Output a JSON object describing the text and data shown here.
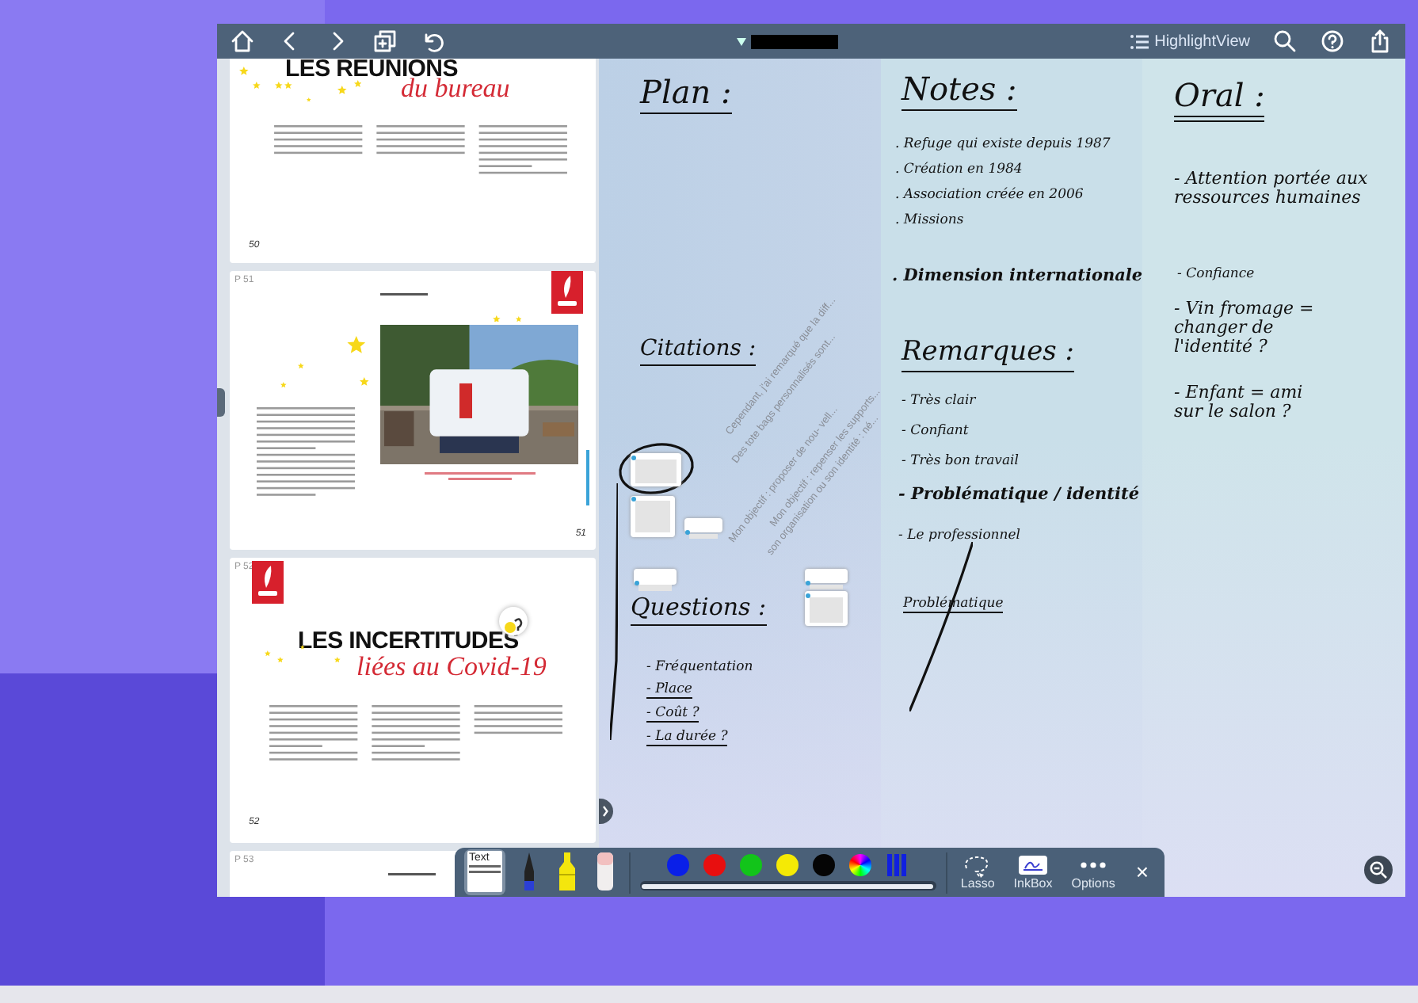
{
  "toolbar": {
    "view_label": "HighlightView"
  },
  "document": {
    "pages": [
      {
        "kind": "title",
        "title": "LES REUNIONS",
        "subtitle": "du bureau",
        "folio": "50"
      },
      {
        "label": "P 51",
        "folio": "51"
      },
      {
        "kind": "title",
        "label": "P 52",
        "title": "LES INCERTITUDES",
        "subtitle": "liées au Covid-19",
        "folio": "52"
      },
      {
        "kind": "stub",
        "label": "P 53"
      }
    ]
  },
  "workspace": {
    "notes": [
      {
        "kind": "heading",
        "text": "Plan :"
      },
      {
        "kind": "heading",
        "text": "Citations :"
      },
      {
        "kind": "heading",
        "text": "Questions :"
      },
      {
        "kind": "line",
        "text": "- Fréquentation"
      },
      {
        "kind": "line",
        "text": "- Place"
      },
      {
        "kind": "line",
        "text": "- Coût ?"
      },
      {
        "kind": "line",
        "text": "- La durée ?"
      },
      {
        "kind": "heading",
        "text": "Notes :"
      },
      {
        "kind": "line",
        "text": ". Refuge qui existe depuis 1987"
      },
      {
        "kind": "line",
        "text": ". Création en 1984"
      },
      {
        "kind": "line",
        "text": ". Association créée en 2006"
      },
      {
        "kind": "line",
        "text": ". Missions"
      },
      {
        "kind": "emphasis",
        "text": ". Dimension internationale"
      },
      {
        "kind": "heading",
        "text": "Remarques :"
      },
      {
        "kind": "line",
        "text": "- Très clair"
      },
      {
        "kind": "line",
        "text": "- Confiant"
      },
      {
        "kind": "line",
        "text": "- Très bon travail"
      },
      {
        "kind": "emphasis",
        "text": "- Problématique / identité"
      },
      {
        "kind": "line",
        "text": "- Le professionnel"
      },
      {
        "kind": "line",
        "text": "Problématique"
      },
      {
        "kind": "heading",
        "text": "Oral :"
      },
      {
        "kind": "line",
        "text": "- Attention portée aux ressources humaines"
      },
      {
        "kind": "line",
        "text": "- Confiance"
      },
      {
        "kind": "line",
        "text": "- Vin fromage = changer de l'identité ?"
      },
      {
        "kind": "line",
        "text": "- Enfant = ami sur le salon ?"
      }
    ],
    "excerpts": [
      "Cependant, j'ai remarqué que la diff...",
      "Des tote bags personnalisés sont...",
      "Mon objectif : proposer de nou- vell...",
      "Mon objectif : repenser les supports...",
      "son organisation ou son identité : né..."
    ]
  },
  "ink_toolbar": {
    "tools": [
      {
        "kind": "text",
        "label": "Text",
        "selected": true
      },
      {
        "kind": "pen",
        "selected": false
      },
      {
        "kind": "highlighter",
        "selected": false
      },
      {
        "kind": "eraser",
        "selected": false
      }
    ],
    "colors": [
      {
        "color": "#0a1fe8"
      },
      {
        "color": "#e80f0f"
      },
      {
        "color": "#12c41a"
      },
      {
        "color": "#f5ea05"
      },
      {
        "color": "#050505"
      }
    ],
    "width_slider": {
      "level": 1
    },
    "actions": [
      "Lasso",
      "InkBox",
      "Options"
    ],
    "close": "×"
  }
}
